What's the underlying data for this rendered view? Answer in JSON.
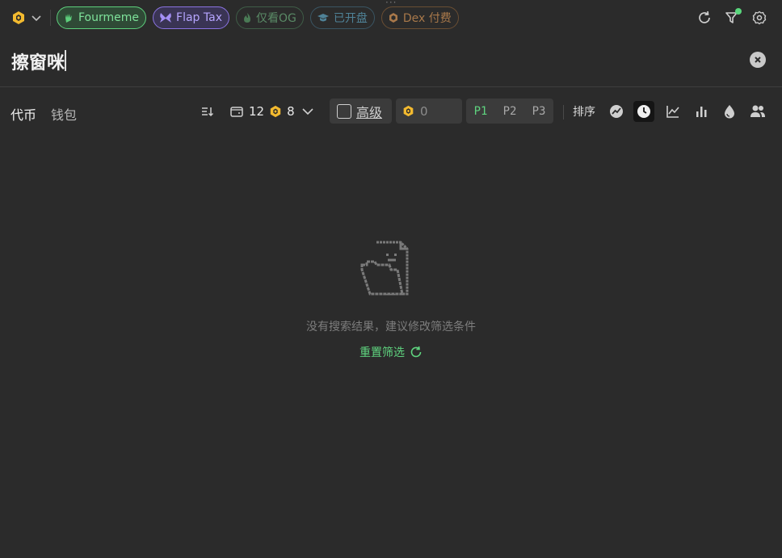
{
  "topbar": {
    "chain": {
      "icon": "bnb-chain-icon",
      "accent": "#f3ba2f"
    },
    "tags": [
      {
        "label": "Fourmeme",
        "icon": "fourmeme-hand-icon",
        "active": true,
        "color": "#7ee29a"
      },
      {
        "label": "Flap Tax",
        "icon": "butterfly-icon",
        "active": true,
        "color": "#b6a5ff"
      },
      {
        "label": "仅看OG",
        "icon": "flame-icon",
        "active": false,
        "color": "#5a8a66"
      },
      {
        "label": "已开盘",
        "icon": "graduation-cap-icon",
        "active": false,
        "color": "#4f8297"
      },
      {
        "label": "Dex 付费",
        "icon": "bnb-coin-icon",
        "active": false,
        "color": "#a8784a"
      }
    ],
    "actions": [
      "refresh-icon",
      "filter-icon",
      "settings-icon"
    ]
  },
  "search": {
    "value": "擦窗咪"
  },
  "tabs": [
    {
      "label": "代币",
      "active": true
    },
    {
      "label": "钱包",
      "active": false
    }
  ],
  "filters": {
    "wallet_count": "12",
    "bnb_count": "8",
    "advanced_label": "高级",
    "amount_value": "0",
    "pages": [
      {
        "label": "P1",
        "active": true
      },
      {
        "label": "P2",
        "active": false
      },
      {
        "label": "P3",
        "active": false
      }
    ],
    "sort_label": "排序",
    "sort_options": [
      {
        "icon": "trend-chart-icon",
        "active": false
      },
      {
        "icon": "clock-icon",
        "active": true
      },
      {
        "icon": "line-chart-icon",
        "active": false
      },
      {
        "icon": "bar-chart-icon",
        "active": false
      },
      {
        "icon": "droplet-icon",
        "active": false
      },
      {
        "icon": "users-icon",
        "active": false
      }
    ]
  },
  "empty_state": {
    "message": "没有搜索结果，建议修改筛选条件",
    "reset_label": "重置筛选"
  },
  "colors": {
    "background": "#2b2b2b",
    "accent_green": "#5fd47f",
    "bnb_yellow": "#f3ba2f"
  }
}
